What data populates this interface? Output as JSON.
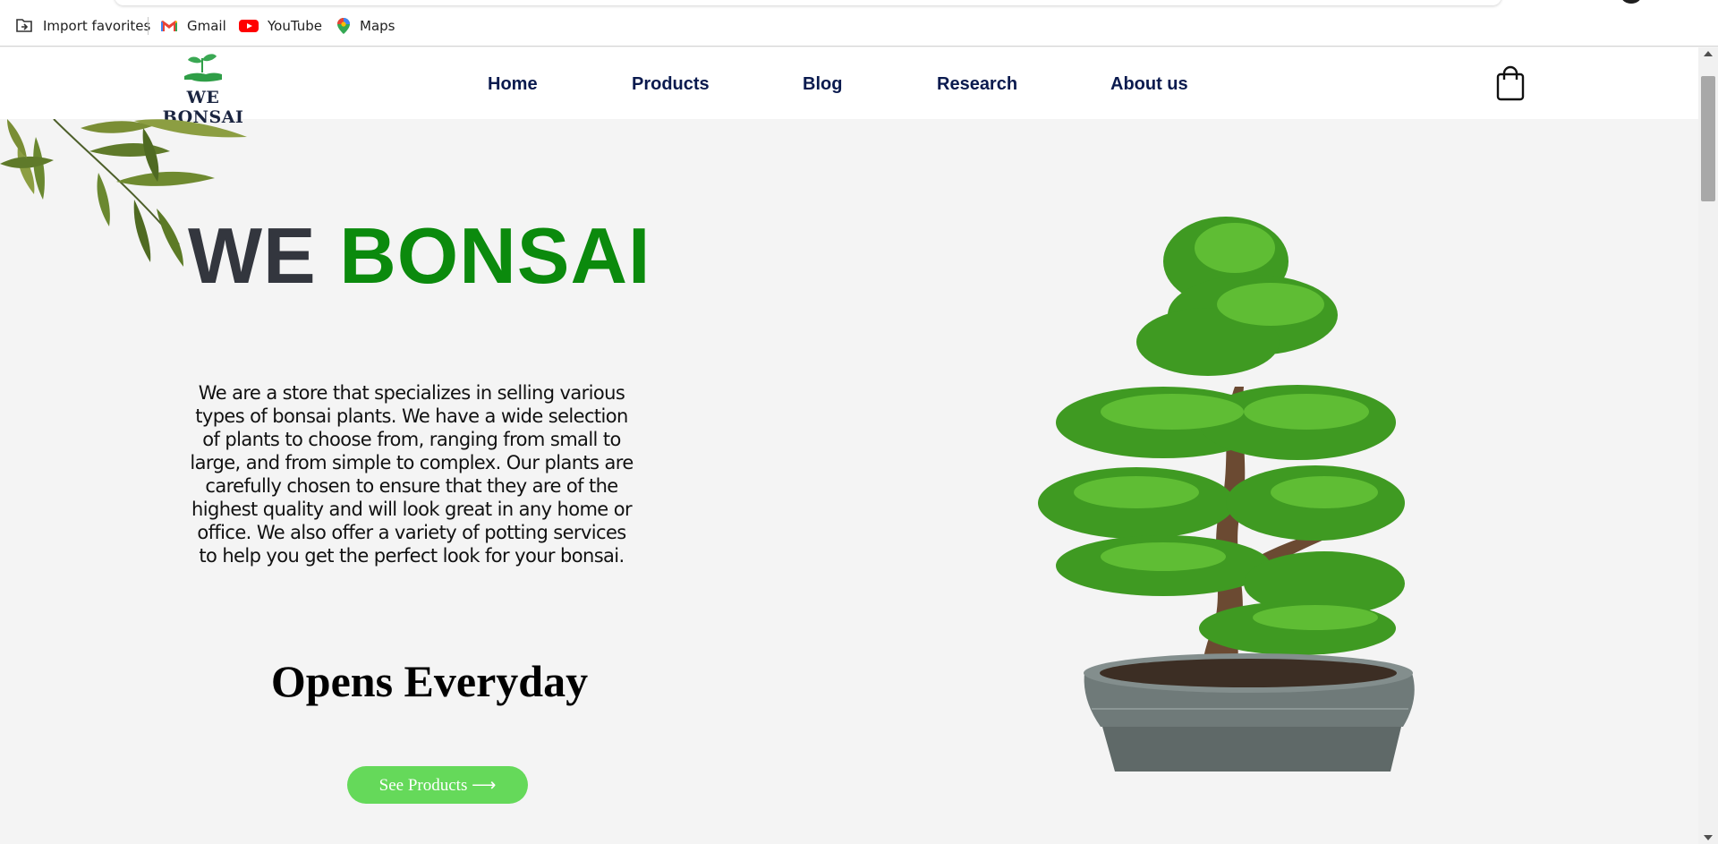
{
  "browser": {
    "bookmarks": [
      {
        "label": "Import favorites",
        "icon": "import-favorites-icon"
      },
      {
        "label": "Gmail",
        "icon": "gmail-icon"
      },
      {
        "label": "YouTube",
        "icon": "youtube-icon"
      },
      {
        "label": "Maps",
        "icon": "maps-icon"
      }
    ]
  },
  "site": {
    "logo_text": "WE BONSAI",
    "nav": [
      "Home",
      "Products",
      "Blog",
      "Research",
      "About us"
    ],
    "cart_icon": "shopping-bag-icon"
  },
  "hero": {
    "title_part1": "WE",
    "title_part2": "BONSAI",
    "description": "We are a store that specializes in selling various types of bonsai plants. We have a wide selection of plants to choose from, ranging from small to large, and from simple to complex. Our plants are carefully chosen to ensure that they are of the highest quality and will look great in any home or office. We also offer a variety of potting services to help you get the perfect look for your bonsai.",
    "hours_heading": "Opens Everyday",
    "cta_label": "See Products ⟶"
  },
  "colors": {
    "accent_green": "#0b8a0d",
    "button_green": "#65d95a",
    "nav_text": "#0a1a4e",
    "title_dark": "#33363e"
  }
}
